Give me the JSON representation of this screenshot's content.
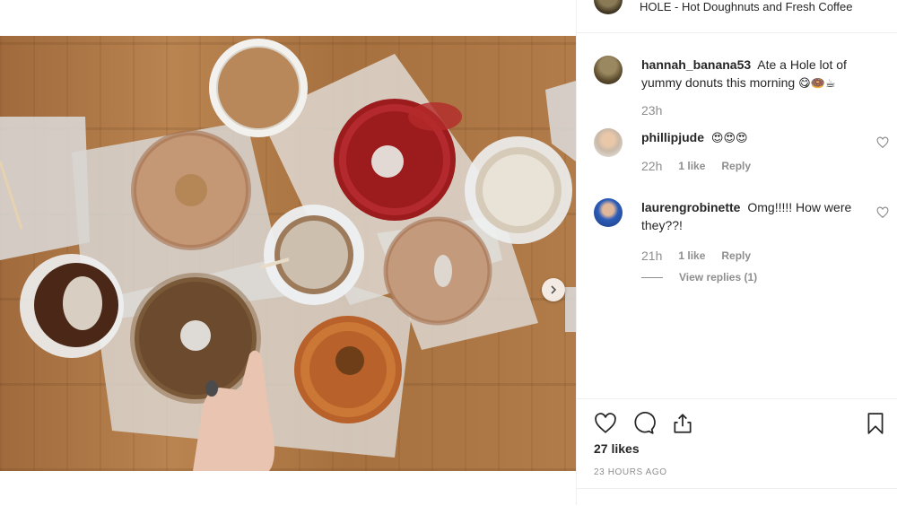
{
  "post": {
    "header_text": "HOLE - Hot Doughnuts and Fresh Coffee"
  },
  "comments": [
    {
      "username": "hannah_banana53",
      "text": "Ate a Hole lot of yummy donuts this morning",
      "emoji": "😋🍩☕",
      "time": "23h",
      "likes": "",
      "reply": ""
    },
    {
      "username": "phillipjude",
      "text": "",
      "emoji": "😍😍😍",
      "time": "22h",
      "likes": "1 like",
      "reply": "Reply"
    },
    {
      "username": "laurengrobinette",
      "text": "Omg!!!!! How were they??!",
      "emoji": "",
      "time": "21h",
      "likes": "1 like",
      "reply": "Reply",
      "view_replies": "View replies (1)"
    }
  ],
  "footer": {
    "likes": "27 likes",
    "time_ago": "23 HOURS AGO"
  },
  "icons": {
    "like": "heart-icon",
    "comment": "comment-icon",
    "share": "share-icon",
    "save": "bookmark-icon",
    "next": "chevron-right-icon"
  },
  "colors": {
    "text": "#262626",
    "secondary": "#8e8e8e",
    "border": "#efefef"
  }
}
